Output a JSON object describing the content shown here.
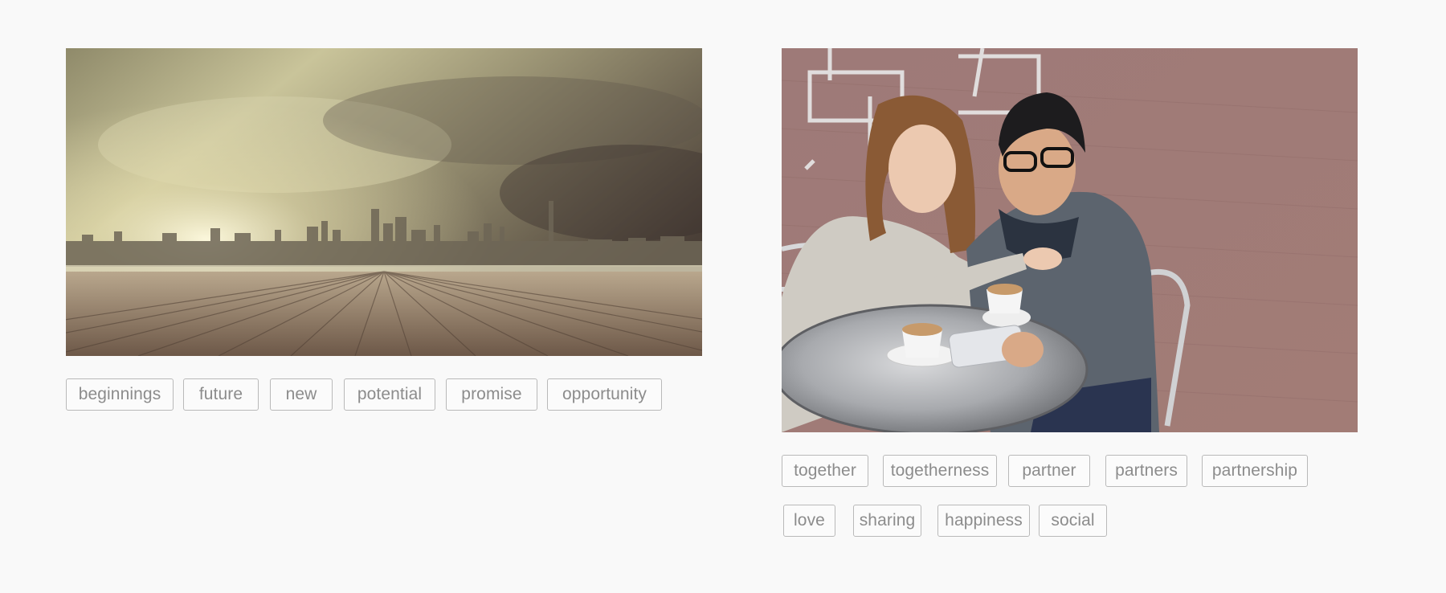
{
  "cards": [
    {
      "image_alt": "city skyline over wooden boardwalk under clouds",
      "tags": [
        "beginnings",
        "future",
        "new",
        "potential",
        "promise",
        "opportunity"
      ]
    },
    {
      "image_alt": "young couple looking at phone at cafe table",
      "tags": [
        "together",
        "togetherness",
        "partner",
        "partners",
        "partnership",
        "love",
        "sharing",
        "happiness",
        "social"
      ]
    }
  ],
  "colors": {
    "background": "#f9f9f9",
    "tag_border": "#b9b9b9",
    "tag_text": "#8c8c8c"
  }
}
